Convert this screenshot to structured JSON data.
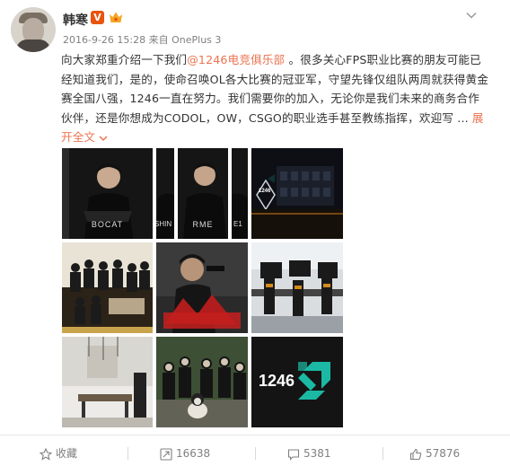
{
  "post": {
    "author": "韩寒",
    "verified_label": "V",
    "date": "2016-9-26 15:28",
    "source_prefix": "来自",
    "source": "OnePlus 3",
    "text_before_link": "向大家郑重介绍一下我们",
    "mention": "@1246电竞俱乐部",
    "text_after_link": " 。很多关心FPS职业比赛的朋友可能已经知道我们，是的，使命召唤OL各大比赛的冠亚军，守望先锋仅组队两周就获得黄金赛全国八强，1246一直在努力。我们需要你的加入，无论你是我们未来的商务合作伙伴，还是你想成为CODOL，OW，CSGO的职业选手甚至教练指挥，欢迎写 ... ",
    "expand_label": "展开全文",
    "images": [
      {
        "caption": "BOCAT"
      },
      {
        "caption": "SHIN"
      },
      {
        "caption": "RME"
      },
      {
        "caption": "E1"
      },
      {
        "caption": "1246"
      },
      {
        "caption": ""
      },
      {
        "caption": ""
      },
      {
        "caption": ""
      },
      {
        "caption": ""
      },
      {
        "caption": ""
      },
      {
        "caption": "1246"
      }
    ]
  },
  "actions": {
    "favorite": "收藏",
    "repost": "16638",
    "comment": "5381",
    "like": "57876"
  },
  "colors": {
    "accent": "#eb7350",
    "verified": "#e8540e",
    "text": "#333333",
    "muted": "#808080",
    "logo_teal": "#1bb9a4"
  }
}
